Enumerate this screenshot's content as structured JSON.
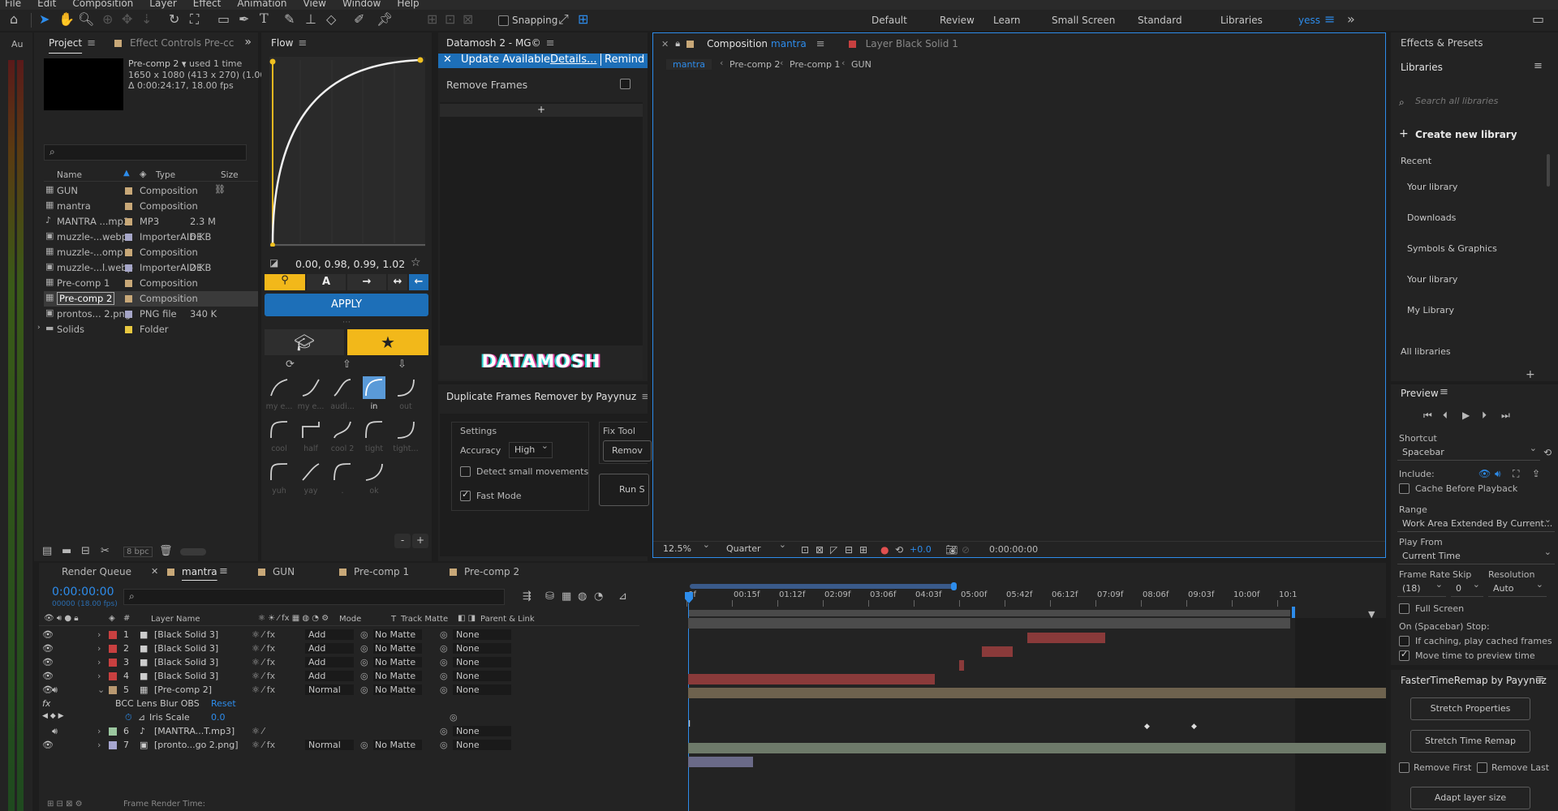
{
  "menubar": [
    "File",
    "Edit",
    "Composition",
    "Layer",
    "Effect",
    "Animation",
    "View",
    "Window",
    "Help"
  ],
  "toolbar": {
    "snapping": "Snapping",
    "workspaces": [
      "Default",
      "Review",
      "Learn",
      "Small Screen",
      "Standard",
      "Libraries"
    ],
    "active_workspace": "yess"
  },
  "left_panel": {
    "label": "Au"
  },
  "project": {
    "tab": "Project",
    "effect_controls_tab": "Effect Controls Pre-cc",
    "selected_name": "Pre-comp 2 ▾",
    "used": ", used 1 time",
    "dims": "1650 x 1080  (413 x 270) (1.00)",
    "duration": "Δ 0:00:24:17, 18.00 fps",
    "columns": {
      "name": "Name",
      "type": "Type",
      "size": "Size"
    },
    "items": [
      {
        "name": "GUN",
        "type": "Composition",
        "size": "",
        "icon": "comp",
        "color": "#c8a878"
      },
      {
        "name": "mantra",
        "type": "Composition",
        "size": "",
        "icon": "comp",
        "color": "#c8a878"
      },
      {
        "name": "MANTRA ...mp3",
        "type": "MP3",
        "size": "2.3 M",
        "icon": "file",
        "color": "#c8a878"
      },
      {
        "name": "muzzle-...webp",
        "type": "ImporterAIDE",
        "size": "6 KB",
        "icon": "img",
        "color": "#a6a6c8"
      },
      {
        "name": "muzzle-...omp 1",
        "type": "Composition",
        "size": "",
        "icon": "comp",
        "color": "#c8a878"
      },
      {
        "name": "muzzle-...l.webp",
        "type": "ImporterAIDE",
        "size": "2 KB",
        "icon": "img",
        "color": "#a6a6c8"
      },
      {
        "name": "Pre-comp 1",
        "type": "Composition",
        "size": "",
        "icon": "comp",
        "color": "#c8a878"
      },
      {
        "name": "Pre-comp 2",
        "type": "Composition",
        "size": "",
        "icon": "comp",
        "color": "#c8a878",
        "selected": true
      },
      {
        "name": "prontos... 2.png",
        "type": "PNG file",
        "size": "340 K",
        "icon": "img",
        "color": "#a6a6c8"
      },
      {
        "name": "Solids",
        "type": "Folder",
        "size": "",
        "icon": "folder",
        "color": "#e8c840"
      }
    ],
    "bpc": "8 bpc"
  },
  "flow": {
    "tab": "Flow",
    "values": "0.00, 0.98, 0.99, 1.02",
    "apply": "APPLY",
    "ease_buttons": [
      "A",
      "→",
      "↔",
      "←"
    ],
    "presets": [
      {
        "label": "my e...",
        "active": false
      },
      {
        "label": "my e...",
        "active": false
      },
      {
        "label": "audi...",
        "active": false
      },
      {
        "label": "in",
        "active": true
      },
      {
        "label": "out",
        "active": false
      },
      {
        "label": "cool",
        "active": false
      },
      {
        "label": "half",
        "active": false
      },
      {
        "label": "cool 2",
        "active": false
      },
      {
        "label": "tight",
        "active": false
      },
      {
        "label": "tight...",
        "active": false
      },
      {
        "label": "yuh",
        "active": false
      },
      {
        "label": "yay",
        "active": false
      },
      {
        "label": ".",
        "active": false
      },
      {
        "label": "ok",
        "active": false
      }
    ]
  },
  "datamosh": {
    "tab": "Datamosh 2 - MG©",
    "banner": {
      "update": "Update Available",
      "details": "Details...",
      "remind": "Remind M"
    },
    "remove_frames": "Remove Frames",
    "add": "+",
    "logo": "DATAMOSH"
  },
  "dupe": {
    "tab": "Duplicate Frames Remover by Payynuz",
    "settings": "Settings",
    "accuracy_label": "Accuracy",
    "accuracy": "High",
    "detect": "Detect small movements",
    "fast": "Fast Mode",
    "fix_tool": "Fix Tool",
    "remove_btn": "Remov",
    "run_btn": "Run S"
  },
  "composition": {
    "tab_prefix": "Composition",
    "tab_name": "mantra",
    "layer_tab": "Layer  Black Solid 1",
    "breadcrumbs": [
      "mantra",
      "Pre-comp 2",
      "Pre-comp 1",
      "GUN"
    ],
    "zoom": "12.5%",
    "resolution": "Quarter",
    "exposure": "+0.0",
    "timecode": "0:00:00:00"
  },
  "right": {
    "effects_presets": "Effects & Presets",
    "libraries": "Libraries",
    "search_placeholder": "Search all libraries",
    "create": "Create new library",
    "recent": "Recent",
    "recent_items": [
      "Your library",
      "Downloads",
      "Symbols & Graphics",
      "Your library",
      "My Library"
    ],
    "all": "All libraries"
  },
  "preview": {
    "tab": "Preview",
    "shortcut_label": "Shortcut",
    "shortcut": "Spacebar",
    "include": "Include:",
    "cache": "Cache Before Playback",
    "range_label": "Range",
    "range": "Work Area Extended By Current...",
    "play_from_label": "Play From",
    "play_from": "Current Time",
    "frame_rate_label": "Frame Rate",
    "skip_label": "Skip",
    "resolution_label": "Resolution",
    "frame_rate": "(18)",
    "skip": "0",
    "resolution": "Auto",
    "full_screen": "Full Screen",
    "on_stop": "On (Spacebar) Stop:",
    "if_caching": "If caching, play cached frames",
    "move_time": "Move time to preview time"
  },
  "ftr": {
    "tab": "FasterTimeRemap by Payynuz",
    "stretch_props": "Stretch Properties",
    "stretch_remap": "Stretch Time Remap",
    "remove_first": "Remove First",
    "remove_last": "Remove Last",
    "adapt": "Adapt layer size"
  },
  "timeline": {
    "render_queue": "Render Queue",
    "tabs": [
      "mantra",
      "GUN",
      "Pre-comp 1",
      "Pre-comp 2"
    ],
    "timecode": "0:00:00:00",
    "timecode_sub": "00000 (18.00 fps)",
    "columns": {
      "layer_name": "Layer Name",
      "mode": "Mode",
      "t": "T",
      "track_matte": "Track Matte",
      "parent": "Parent & Link"
    },
    "ruler": [
      "0f",
      "00:15f",
      "01:12f",
      "02:09f",
      "03:06f",
      "04:03f",
      "05:00f",
      "05:42f",
      "06:12f",
      "07:09f",
      "08:06f",
      "09:03f",
      "10:00f",
      "10:1"
    ],
    "layers": [
      {
        "num": "1",
        "name": "[Black Solid 3]",
        "mode": "Add",
        "matte": "No Matte",
        "parent": "None",
        "color": "#c84040"
      },
      {
        "num": "2",
        "name": "[Black Solid 3]",
        "mode": "Add",
        "matte": "No Matte",
        "parent": "None",
        "color": "#c84040"
      },
      {
        "num": "3",
        "name": "[Black Solid 3]",
        "mode": "Add",
        "matte": "No Matte",
        "parent": "None",
        "color": "#c84040"
      },
      {
        "num": "4",
        "name": "[Black Solid 3]",
        "mode": "Add",
        "matte": "No Matte",
        "parent": "None",
        "color": "#c84040"
      },
      {
        "num": "5",
        "name": "[Pre-comp 2]",
        "mode": "Normal",
        "matte": "No Matte",
        "parent": "None",
        "color": "#b89870"
      },
      {
        "num": "6",
        "name": "[MANTRA...T.mp3]",
        "mode": "",
        "matte": "",
        "parent": "None",
        "color": "#9cc8a0"
      },
      {
        "num": "7",
        "name": "[pronto...go 2.png]",
        "mode": "Normal",
        "matte": "No Matte",
        "parent": "None",
        "color": "#a6a6d0"
      }
    ],
    "effect": {
      "name": "BCC Lens Blur OBS",
      "reset": "Reset",
      "prop": "Iris Scale",
      "value": "0.0"
    },
    "render_time": "Frame Render Time:"
  }
}
